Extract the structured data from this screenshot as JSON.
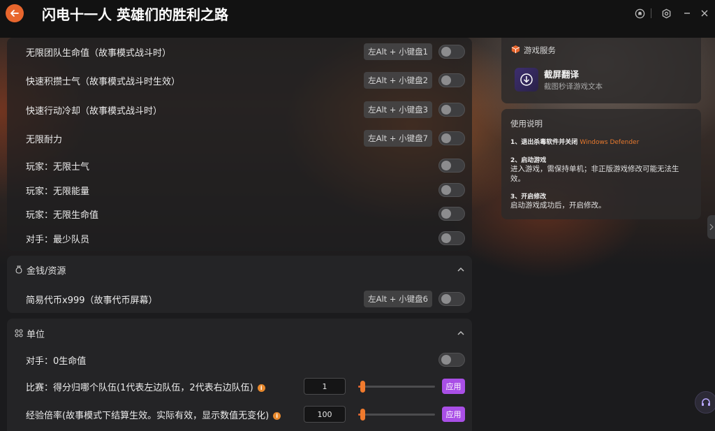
{
  "app": {
    "title": "闪电十一人 英雄们的胜利之路"
  },
  "colors": {
    "accent": "#e8662d",
    "apply": "#a94fe6"
  },
  "main": {
    "top_rows": [
      {
        "label": "无限团队生命值（故事模式战斗时）",
        "hotkey": "左Alt + 小键盘1",
        "enabled": false
      },
      {
        "label": "快速积攒士气（故事模式战斗时生效）",
        "hotkey": "左Alt + 小键盘2",
        "enabled": false
      },
      {
        "label": "快速行动冷却（故事模式战斗时）",
        "hotkey": "左Alt + 小键盘3",
        "enabled": false
      },
      {
        "label": "无限耐力",
        "hotkey": "左Alt + 小键盘7",
        "enabled": false
      },
      {
        "label": "玩家：无限士气",
        "enabled": false
      },
      {
        "label": "玩家：无限能量",
        "enabled": false
      },
      {
        "label": "玩家：无限生命值",
        "enabled": false
      },
      {
        "label": "对手：最少队员",
        "enabled": false
      }
    ],
    "money_section": {
      "title": "金钱/资源",
      "rows": [
        {
          "label": "简易代币x999（故事代币屏幕）",
          "hotkey": "左Alt + 小键盘6",
          "enabled": false
        }
      ]
    },
    "unit_section": {
      "title": "单位",
      "toggle_row": {
        "label": "对手：0生命值",
        "enabled": false
      },
      "slider_rows": [
        {
          "label": "比赛：得分归哪个队伍(1代表左边队伍，2代表右边队伍)",
          "value": "1",
          "slider_fraction": 0.03,
          "apply_label": "应用"
        },
        {
          "label": "经验倍率(故事模式下结算生效。实际有效，显示数值无变化)",
          "value": "100",
          "slider_fraction": 0.03,
          "apply_label": "应用"
        }
      ]
    }
  },
  "side": {
    "service_card": {
      "title": "游戏服务",
      "item_title": "截屏翻译",
      "item_desc": "截图秒译游戏文本"
    },
    "instructions": {
      "title": "使用说明",
      "step1_title": "1、退出杀毒软件并关闭",
      "step1_highlight": "Windows Defender",
      "step2_title": "2、启动游戏",
      "step2_text": "进入游戏，需保持单机；非正版游戏修改可能无法生效。",
      "step3_title": "3、开启修改",
      "step3_text": "启动游戏成功后，开启修改。"
    }
  }
}
